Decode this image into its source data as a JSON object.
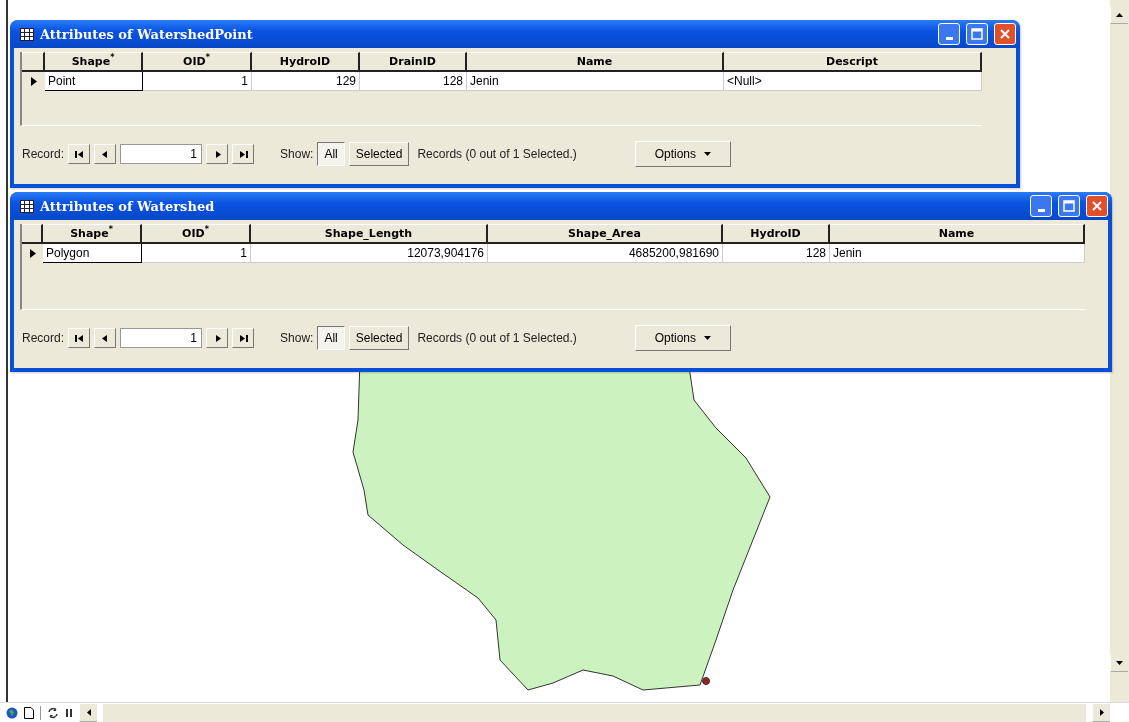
{
  "windows": [
    {
      "title": "Attributes of WatershedPoint",
      "columns": [
        "Shape$^{*}$",
        "OID$^{*}$",
        "HydroID",
        "DrainID",
        "Name",
        "Descript"
      ],
      "rows": [
        {
          "cells": [
            {
              "text": "Point",
              "kind": "text"
            },
            {
              "text": "1",
              "kind": "number"
            },
            {
              "text": "129",
              "kind": "number"
            },
            {
              "text": "128",
              "kind": "number"
            },
            {
              "text": "Jenin",
              "kind": "text"
            },
            {
              "text": "<Null>",
              "kind": "text"
            }
          ]
        }
      ],
      "record_label": "Record:",
      "record": "1",
      "show_label": "Show:",
      "show": [
        {
          "label": "All",
          "selected": true
        },
        {
          "label": "Selected",
          "selected": false
        }
      ],
      "status": "Records (0 out of 1 Selected.)",
      "options": "Options"
    },
    {
      "title": "Attributes of Watershed",
      "columns": [
        "Shape$^{*}$",
        "OID$^{*}$",
        "Shape_Length",
        "Shape_Area",
        "HydroID",
        "Name"
      ],
      "rows": [
        {
          "cells": [
            {
              "text": "Polygon",
              "kind": "text"
            },
            {
              "text": "1",
              "kind": "number"
            },
            {
              "text": "12073,904176",
              "kind": "number"
            },
            {
              "text": "4685200,981690",
              "kind": "number"
            },
            {
              "text": "128",
              "kind": "number"
            },
            {
              "text": "Jenin",
              "kind": "text"
            }
          ]
        }
      ],
      "record_label": "Record:",
      "record": "1",
      "show_label": "Show:",
      "show": [
        {
          "label": "All",
          "selected": true
        },
        {
          "label": "Selected",
          "selected": false
        }
      ],
      "status": "Records (0 out of 1 Selected.)",
      "options": "Options"
    }
  ]
}
